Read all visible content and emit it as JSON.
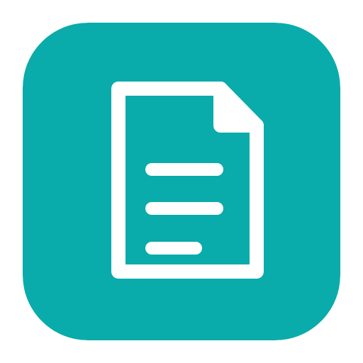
{
  "icon": {
    "name": "document-icon",
    "tile_color": "#0aabab",
    "glyph_color": "#ffffff"
  }
}
